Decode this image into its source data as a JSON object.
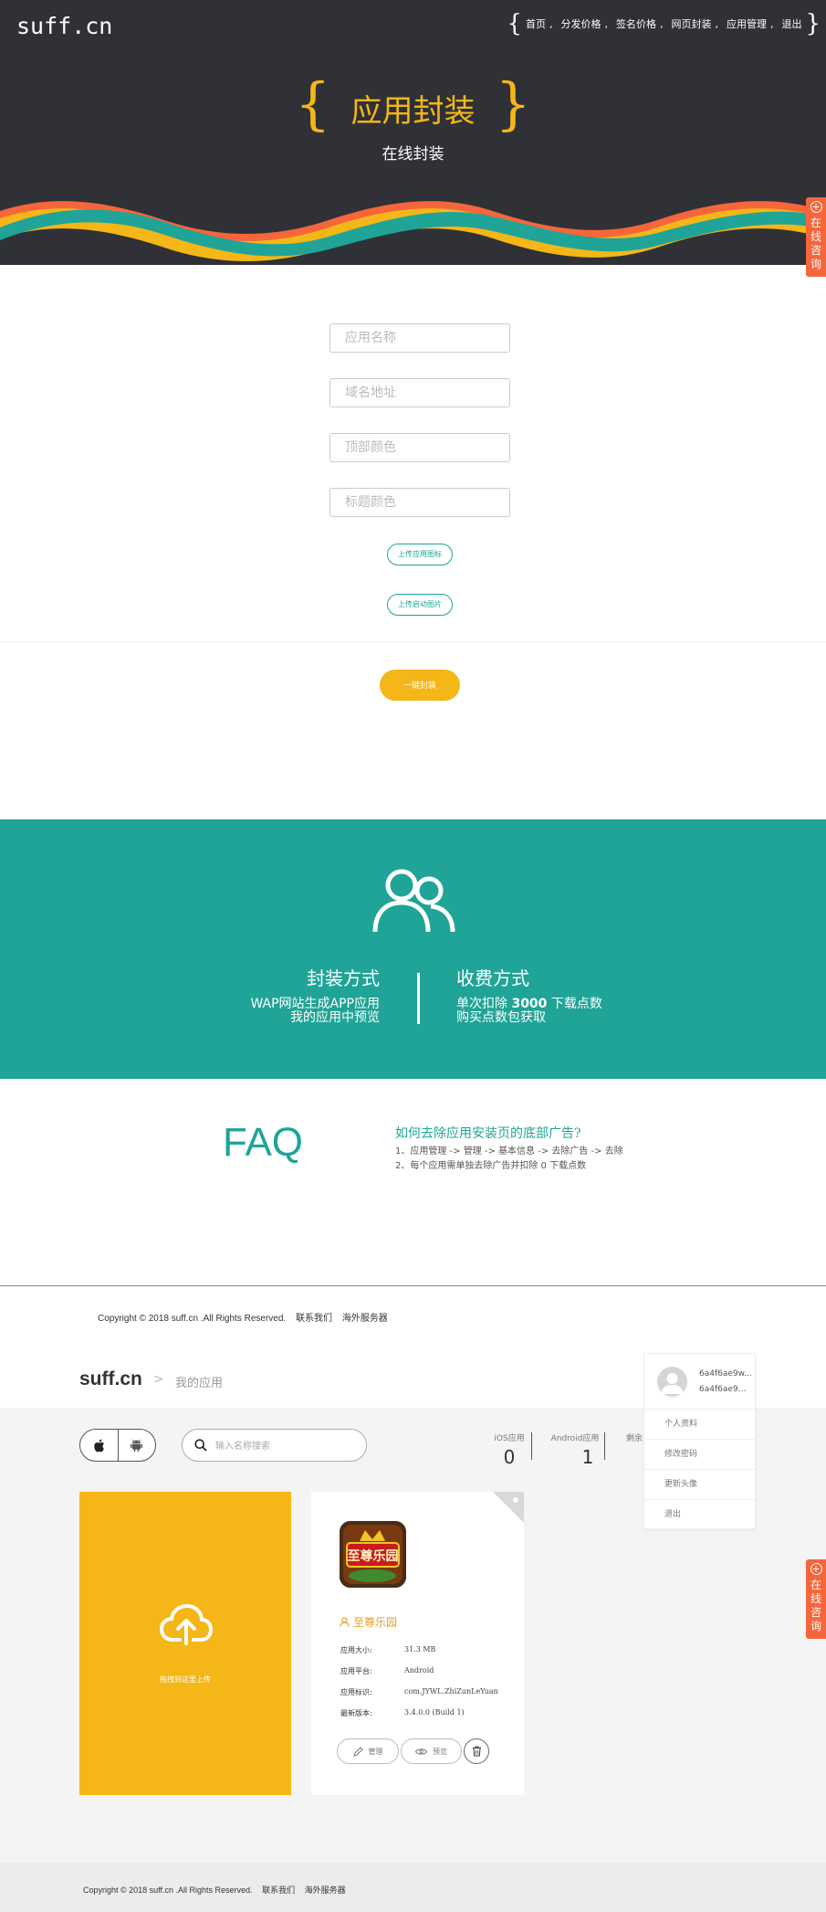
{
  "site": {
    "logo": "suff.cn"
  },
  "nav": {
    "items": [
      "首页",
      "分发价格",
      "签名价格",
      "网页封装",
      "应用管理",
      "退出"
    ],
    "separator": ","
  },
  "hero": {
    "title": "应用封装",
    "subtitle": "在线封装"
  },
  "consult": {
    "label": "在线咨询"
  },
  "form": {
    "app_name_placeholder": "应用名称",
    "domain_placeholder": "域名地址",
    "top_color_placeholder": "顶部颜色",
    "title_color_placeholder": "标题颜色",
    "upload_icon_label": "上传应用图标",
    "upload_splash_label": "上传启动图片",
    "submit_label": "一键封装"
  },
  "features": {
    "packaging": {
      "title": "封装方式",
      "line1": "WAP网站生成APP应用",
      "line2": "我的应用中预览"
    },
    "billing": {
      "title": "收费方式",
      "line1_prefix": "单次扣除 ",
      "line1_amount": "3000",
      "line1_suffix": " 下载点数",
      "line2": "购买点数包获取"
    }
  },
  "faq": {
    "title": "FAQ",
    "question": "如何去除应用安装页的底部广告?",
    "answer1": "1、应用管理 -> 管理 -> 基本信息 -> 去除广告 -> 去除",
    "answer2": "2、每个应用需单独去除广告并扣除 0 下载点数"
  },
  "footer": {
    "copyright": "Copyright © 2018 suff.cn .All Rights Reserved.",
    "contact": "联系我们",
    "overseas": "海外服务器"
  },
  "apps_page": {
    "logo": "suff.cn",
    "breadcrumb": "我的应用",
    "search_placeholder": "输入名称搜索",
    "stats": [
      {
        "label": "iOS应用",
        "value": "0"
      },
      {
        "label": "Android应用",
        "value": "1"
      },
      {
        "label": "剩余"
      }
    ],
    "upload_card_label": "拖拽到这里上传",
    "app": {
      "name": "至尊乐园",
      "icon_text": "至尊乐园",
      "rows": [
        {
          "label": "应用大小:",
          "value": "31.3 MB"
        },
        {
          "label": "应用平台:",
          "value": "Android"
        },
        {
          "label": "应用标识:",
          "value": "com.JYWL.ZhiZunLeYuan"
        },
        {
          "label": "最新版本:",
          "value": "3.4.0.0 (Build 1)"
        }
      ],
      "manage_label": "管理",
      "preview_label": "预览"
    },
    "user_menu": {
      "username_line1": "6a4f6ae9w...",
      "username_line2": "6a4f6ae9w9f...",
      "items": [
        "个人资料",
        "修改密码",
        "更新头像",
        "退出"
      ]
    }
  },
  "colors": {
    "dark_bg": "#2f3136",
    "accent_yellow": "#f5b617",
    "teal": "#1fa497",
    "orange": "#f5663b"
  }
}
